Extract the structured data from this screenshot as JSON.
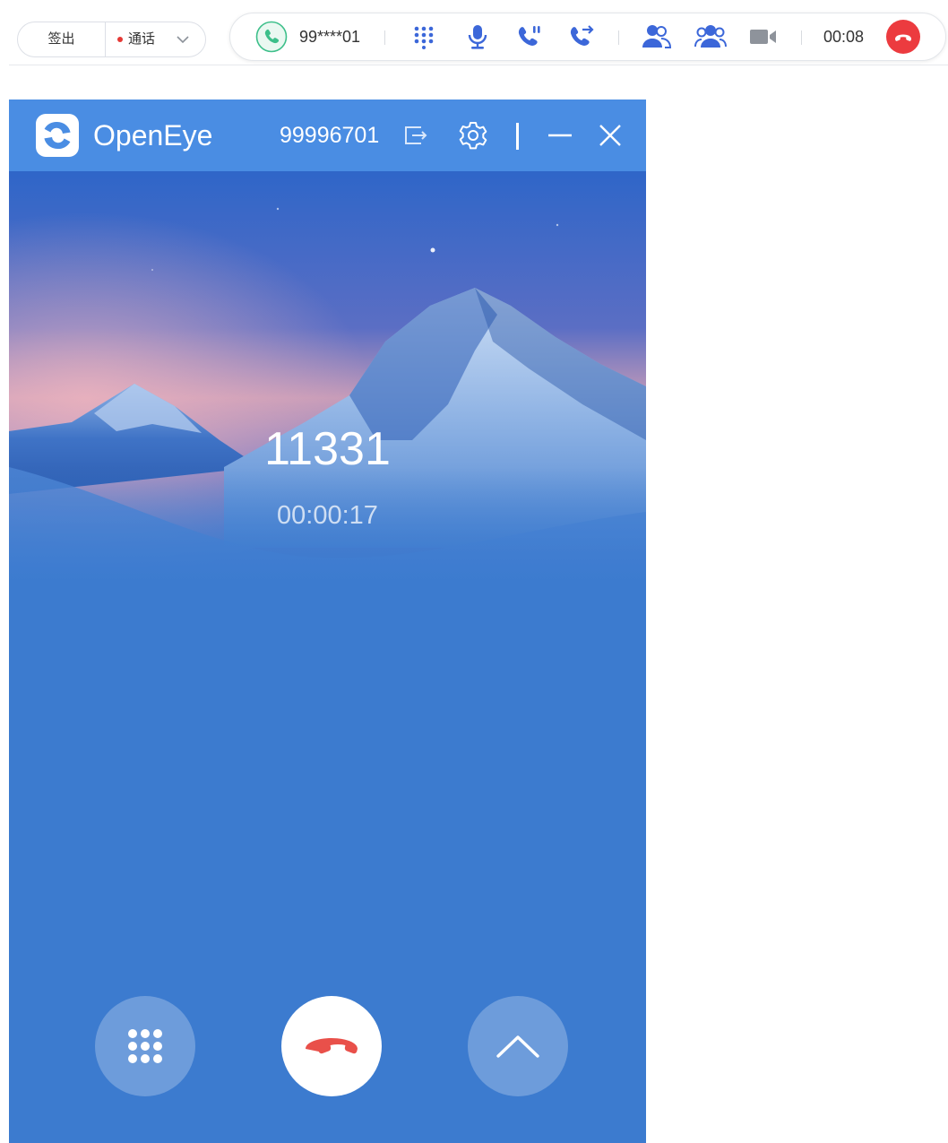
{
  "toolbar": {
    "signout_label": "签出",
    "status_label": "通话",
    "caller_masked": "99****01",
    "elapsed": "00:08",
    "icons": [
      "phone-icon",
      "dialpad-icon",
      "microphone-icon",
      "call-hold-icon",
      "call-transfer-icon",
      "consult-icon",
      "conference-icon",
      "video-icon",
      "hangup-icon"
    ]
  },
  "window": {
    "app_name": "OpenEye",
    "account": "99996701",
    "icons": [
      "logout-icon",
      "settings-icon",
      "minimize-icon",
      "close-icon"
    ]
  },
  "call": {
    "number": "11331",
    "duration": "00:00:17",
    "controls": [
      "dialpad-icon",
      "hangup-icon",
      "chevron-up-icon"
    ]
  },
  "colors": {
    "accent": "#3c67d9",
    "window_blue": "#3c7bcf",
    "titlebar_blue": "#4a8de3",
    "hangup_red": "#ec3b3f",
    "status_red": "#e53935",
    "phone_green": "#3dbf8a"
  }
}
